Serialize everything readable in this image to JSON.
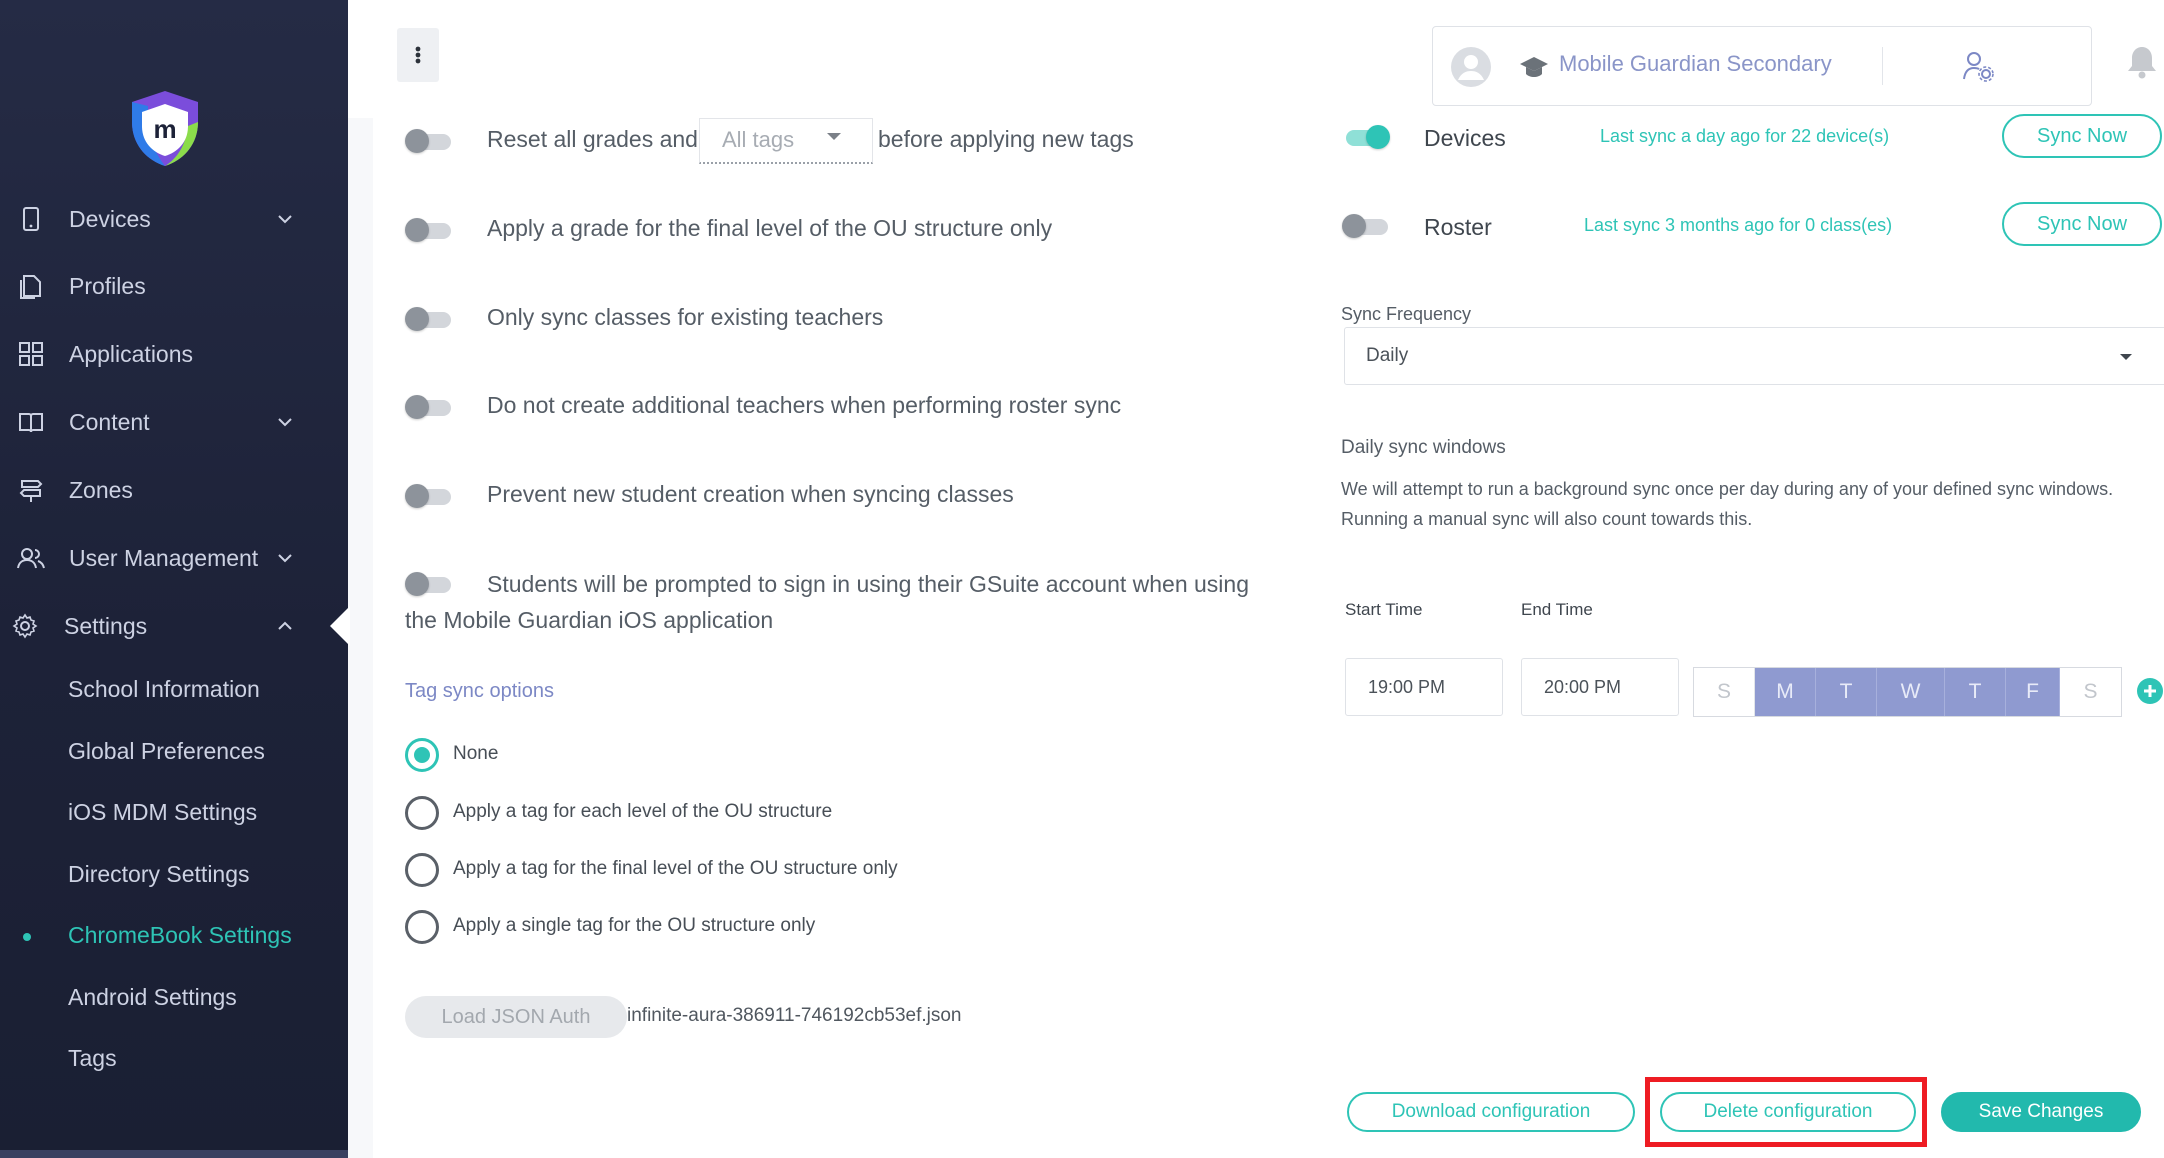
{
  "sidebar": {
    "nav": [
      {
        "label": "Devices",
        "icon": "tablet-icon",
        "has_chevron": true
      },
      {
        "label": "Profiles",
        "icon": "profiles-icon",
        "has_chevron": false
      },
      {
        "label": "Applications",
        "icon": "grid-icon",
        "has_chevron": false
      },
      {
        "label": "Content",
        "icon": "book-icon",
        "has_chevron": true
      },
      {
        "label": "Zones",
        "icon": "signpost-icon",
        "has_chevron": false
      },
      {
        "label": "User Management",
        "icon": "users-icon",
        "has_chevron": true
      },
      {
        "label": "Settings",
        "icon": "gear-icon",
        "expanded": true
      }
    ],
    "sub": [
      {
        "label": "School Information"
      },
      {
        "label": "Global Preferences"
      },
      {
        "label": "iOS MDM Settings"
      },
      {
        "label": "Directory Settings"
      },
      {
        "label": "ChromeBook Settings",
        "active": true
      },
      {
        "label": "Android Settings"
      },
      {
        "label": "Tags"
      }
    ]
  },
  "header": {
    "org_name": "Mobile Guardian Secondary"
  },
  "options": {
    "reset_grades_prefix": "Reset all grades and",
    "reset_grades_select": "All tags",
    "reset_grades_suffix": "before applying new tags",
    "final_level_grade": "Apply a grade for the final level of the OU structure only",
    "existing_teachers": "Only sync classes for existing teachers",
    "no_additional_teachers": "Do not create additional teachers when performing roster sync",
    "prevent_new_students": "Prevent new student creation when syncing classes",
    "gsuite_prompt": "Students will be prompted to sign in using their GSuite account when using the Mobile Guardian iOS application"
  },
  "tag_sync": {
    "title": "Tag sync options",
    "options": [
      {
        "label": "None",
        "selected": true
      },
      {
        "label": "Apply a tag for each level of the OU structure",
        "selected": false
      },
      {
        "label": "Apply a tag for the final level of the OU structure only",
        "selected": false
      },
      {
        "label": "Apply a single tag for the OU structure only",
        "selected": false
      }
    ]
  },
  "auth": {
    "load_button": "Load JSON Auth",
    "file_name": "infinite-aura-386911-746192cb53ef.json"
  },
  "sync": {
    "devices": {
      "label": "Devices",
      "enabled": true,
      "info": "Last sync a day ago for 22 device(s)",
      "button": "Sync Now"
    },
    "roster": {
      "label": "Roster",
      "enabled": false,
      "info": "Last sync 3 months ago for 0 class(es)",
      "button": "Sync Now"
    },
    "frequency_label": "Sync Frequency",
    "frequency_value": "Daily",
    "windows_title": "Daily sync windows",
    "windows_desc": "We will attempt to run a background sync once per day during any of your defined sync windows. Running a manual sync will also count towards this.",
    "start_label": "Start Time",
    "end_label": "End Time",
    "start_value": "19:00 PM",
    "end_value": "20:00 PM",
    "days": [
      {
        "label": "S",
        "on": false
      },
      {
        "label": "M",
        "on": true
      },
      {
        "label": "T",
        "on": true
      },
      {
        "label": "W",
        "on": true
      },
      {
        "label": "T",
        "on": true
      },
      {
        "label": "F",
        "on": true
      },
      {
        "label": "S",
        "on": false
      }
    ]
  },
  "footer": {
    "download": "Download configuration",
    "delete": "Delete configuration",
    "save": "Save Changes"
  },
  "colors": {
    "accent": "#2ec4b6",
    "sidebar_bg": "#1d2238",
    "highlight": "#ee1c23",
    "day_on": "#8f9ad0"
  }
}
